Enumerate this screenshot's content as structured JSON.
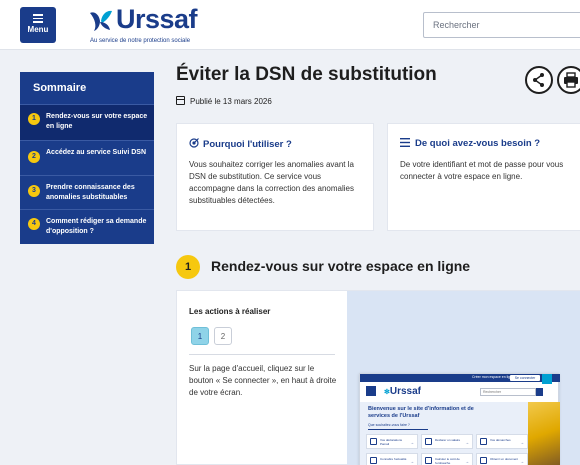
{
  "header": {
    "menu_label": "Menu",
    "logo_text": "Urssaf",
    "logo_tagline": "Au service de notre protection sociale",
    "search_placeholder": "Rechercher"
  },
  "sidebar": {
    "title": "Sommaire",
    "items": [
      {
        "num": "1",
        "label": "Rendez-vous sur votre espace en ligne"
      },
      {
        "num": "2",
        "label": "Accédez au service Suivi DSN"
      },
      {
        "num": "3",
        "label": "Prendre connaissance des anomalies substituables"
      },
      {
        "num": "4",
        "label": "Comment rédiger sa demande d'opposition ?"
      }
    ]
  },
  "page": {
    "title": "Éviter la DSN de substitution",
    "published": "Publié le 13 mars 2026"
  },
  "cards": {
    "why": {
      "title": "Pourquoi l'utiliser ?",
      "body": "Vous souhaitez corriger les anomalies avant la DSN de substitution. Ce service vous accompagne dans la correction des anomalies substituables détectées."
    },
    "need": {
      "title": "De quoi avez-vous besoin ?",
      "body": "De votre identifiant et mot de passe pour vous connecter à votre espace en ligne."
    }
  },
  "section": {
    "num": "1",
    "title": "Rendez-vous sur votre espace en ligne",
    "actions_title": "Les actions à réaliser",
    "steps": [
      "1",
      "2"
    ],
    "instruction": "Sur la page d'accueil, cliquez sur le bouton « Se connecter », en haut à droite de votre écran."
  },
  "screenshot": {
    "logo": "Urssaf",
    "topbar_text": "Créer mon espace en ligne",
    "connect_label": "Se connecter",
    "search_placeholder": "Rechercher",
    "headline": "Bienvenue sur le site d'information et de services de l'Urssaf",
    "question": "Que souhaitez-vous faire ?",
    "tiles": [
      "Vos déclarations Pamail",
      "Déclarer un salaire",
      "Vos démarches",
      "Connaître l'actualité",
      "Calculer le coût de l'embauche",
      "Obtenir un document"
    ]
  },
  "colors": {
    "brand_blue": "#1a3c8a",
    "accent_yellow": "#f6c80f",
    "step_active": "#8fd3e8"
  }
}
